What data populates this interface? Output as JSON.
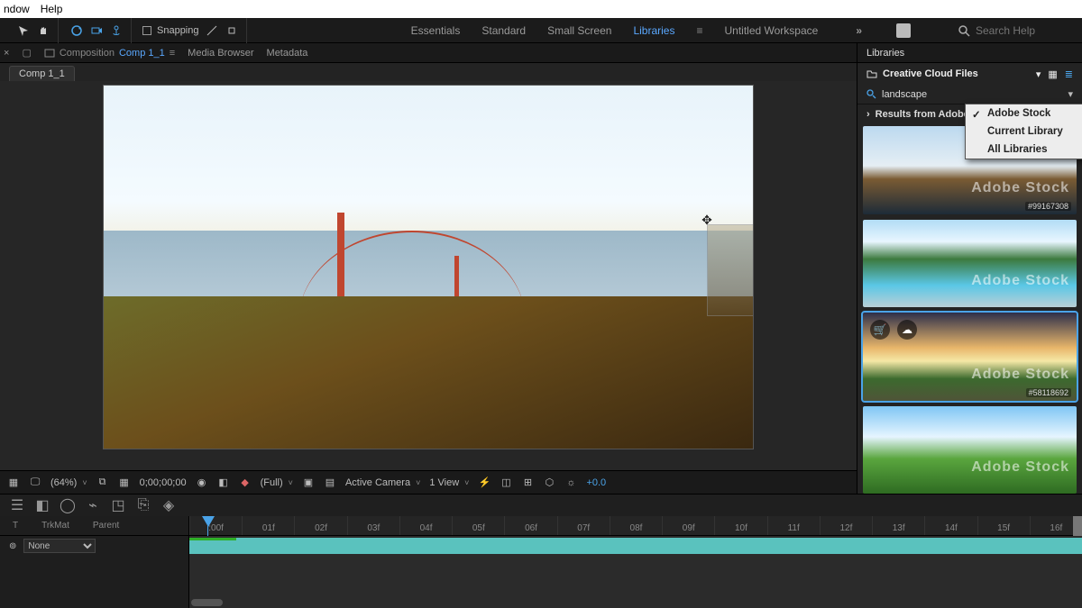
{
  "menu": {
    "window": "ndow",
    "help": "Help"
  },
  "toolbar": {
    "snapping": "Snapping"
  },
  "workspaces": {
    "items": [
      "Essentials",
      "Standard",
      "Small Screen",
      "Libraries",
      "Untitled Workspace"
    ],
    "active_index": 3
  },
  "search_help": {
    "placeholder": "Search Help"
  },
  "comp_panel": {
    "composition_label": "Composition",
    "comp_name": "Comp 1_1",
    "browser_tab": "Media Browser",
    "metadata_tab": "Metadata",
    "flow_tab": "Comp 1_1"
  },
  "viewer": {
    "zoom": "(64%)",
    "timecode": "0;00;00;00",
    "resolution": "(Full)",
    "camera": "Active Camera",
    "view_count": "1 View",
    "exposure": "+0.0"
  },
  "libraries": {
    "title": "Libraries",
    "cc_label": "Creative Cloud Files",
    "search_value": "landscape",
    "results_label": "Results from Adobe",
    "popup": {
      "adobe_stock": "Adobe Stock",
      "current_library": "Current Library",
      "all_libraries": "All Libraries"
    },
    "watermark": "Adobe Stock",
    "ids": {
      "t1": "#99167308",
      "t3": "#58118692"
    }
  },
  "timeline": {
    "cols": {
      "t": "T",
      "trkmat": "TrkMat",
      "parent": "Parent"
    },
    "parent_value": "None",
    "frames": [
      ":00f",
      "01f",
      "02f",
      "03f",
      "04f",
      "05f",
      "06f",
      "07f",
      "08f",
      "09f",
      "10f",
      "11f",
      "12f",
      "13f",
      "14f",
      "15f",
      "16f"
    ]
  }
}
